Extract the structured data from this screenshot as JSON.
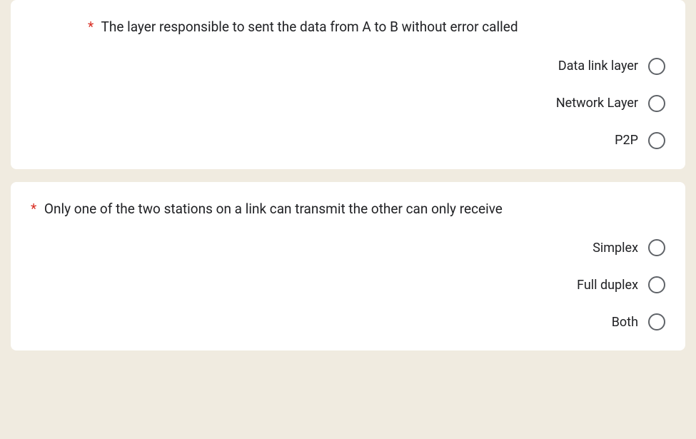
{
  "questions": [
    {
      "required_marker": "*",
      "text": "The layer responsible to sent the data from A to B without error called",
      "options": [
        {
          "label": "Data link layer"
        },
        {
          "label": "Network Layer"
        },
        {
          "label": "P2P"
        }
      ]
    },
    {
      "required_marker": "*",
      "text": "Only one of the two stations on a link can transmit the other can only receive",
      "options": [
        {
          "label": "Simplex"
        },
        {
          "label": "Full duplex"
        },
        {
          "label": "Both"
        }
      ]
    }
  ]
}
